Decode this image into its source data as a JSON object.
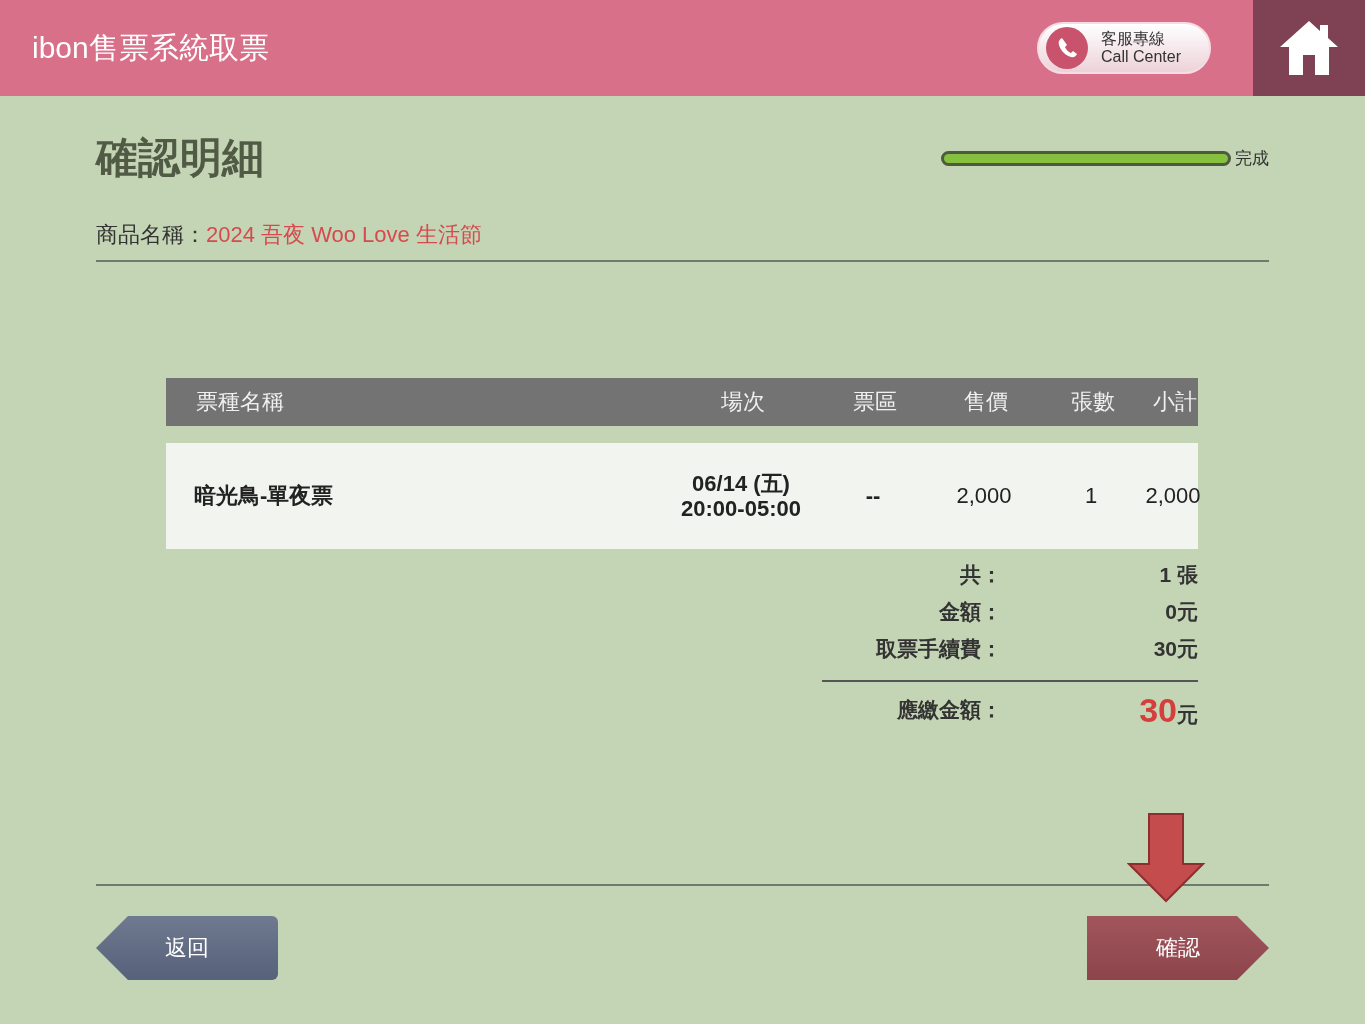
{
  "header": {
    "title": "ibon售票系統取票",
    "call_center": {
      "label_zh": "客服專線",
      "label_en": "Call Center"
    }
  },
  "page_title": "確認明細",
  "progress": {
    "level": 1,
    "label": "完成"
  },
  "product": {
    "label": "商品名稱：",
    "name": "2024 吾夜 Woo Love 生活節"
  },
  "table": {
    "columns": [
      "票種名稱",
      "場次",
      "票區",
      "售價",
      "張數",
      "小計"
    ],
    "rows": [
      {
        "ticket_type": "暗光鳥-單夜票",
        "session": [
          "06/14 (五)",
          "20:00-05:00"
        ],
        "zone": "--",
        "price": "2,000",
        "quantity": "1",
        "subtotal": "2,000"
      }
    ]
  },
  "summary": [
    {
      "label": "共：",
      "value": "1 張",
      "kind": "normal"
    },
    {
      "label": "金額：",
      "value": "0元",
      "kind": "normal"
    },
    {
      "label": "取票手續費：",
      "value": "30元",
      "kind": "normal"
    },
    {
      "label": "應繳金額：",
      "value": "30",
      "unit": "元",
      "kind": "total"
    }
  ],
  "buttons": {
    "back": "返回",
    "confirm": "確認"
  }
}
